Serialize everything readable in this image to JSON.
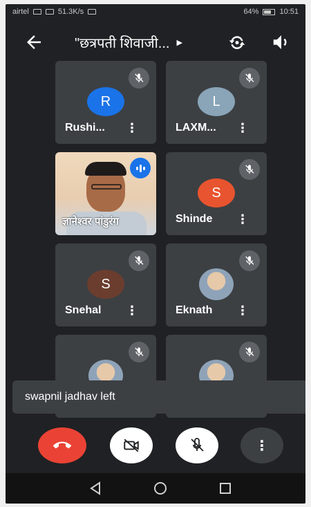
{
  "status_bar": {
    "carrier": "airtel",
    "network_speed": "51.3K/s",
    "battery": "64%",
    "time": "10:51"
  },
  "app_bar": {
    "title": "\"छत्रपती शिवाजी..."
  },
  "participants": [
    {
      "name": "Rushi...",
      "initial": "R",
      "avatar_color": "#1a73e8",
      "muted": true
    },
    {
      "name": "LAXM...",
      "initial": "L",
      "avatar_color": "#8aa4b8",
      "muted": true
    },
    {
      "name": "ज्ञानेश्वर पांडुरंग",
      "muted": false,
      "video": true,
      "speaking": true
    },
    {
      "name": "Shinde",
      "initial": "S",
      "avatar_color": "#e8542f",
      "muted": true
    },
    {
      "name": "Snehal",
      "initial": "S",
      "avatar_color": "#6b3d2e",
      "muted": true
    },
    {
      "name": "Eknath",
      "avatar_type": "photo",
      "muted": true
    },
    {
      "name": "",
      "avatar_type": "photo",
      "muted": true
    },
    {
      "name": "",
      "avatar_type": "photo",
      "muted": true
    }
  ],
  "toast": {
    "message": "swapnil jadhav left"
  },
  "colors": {
    "background": "#202124",
    "tile": "#3c4043",
    "end_call": "#ea4335",
    "speaking_indicator": "#1a73e8"
  }
}
